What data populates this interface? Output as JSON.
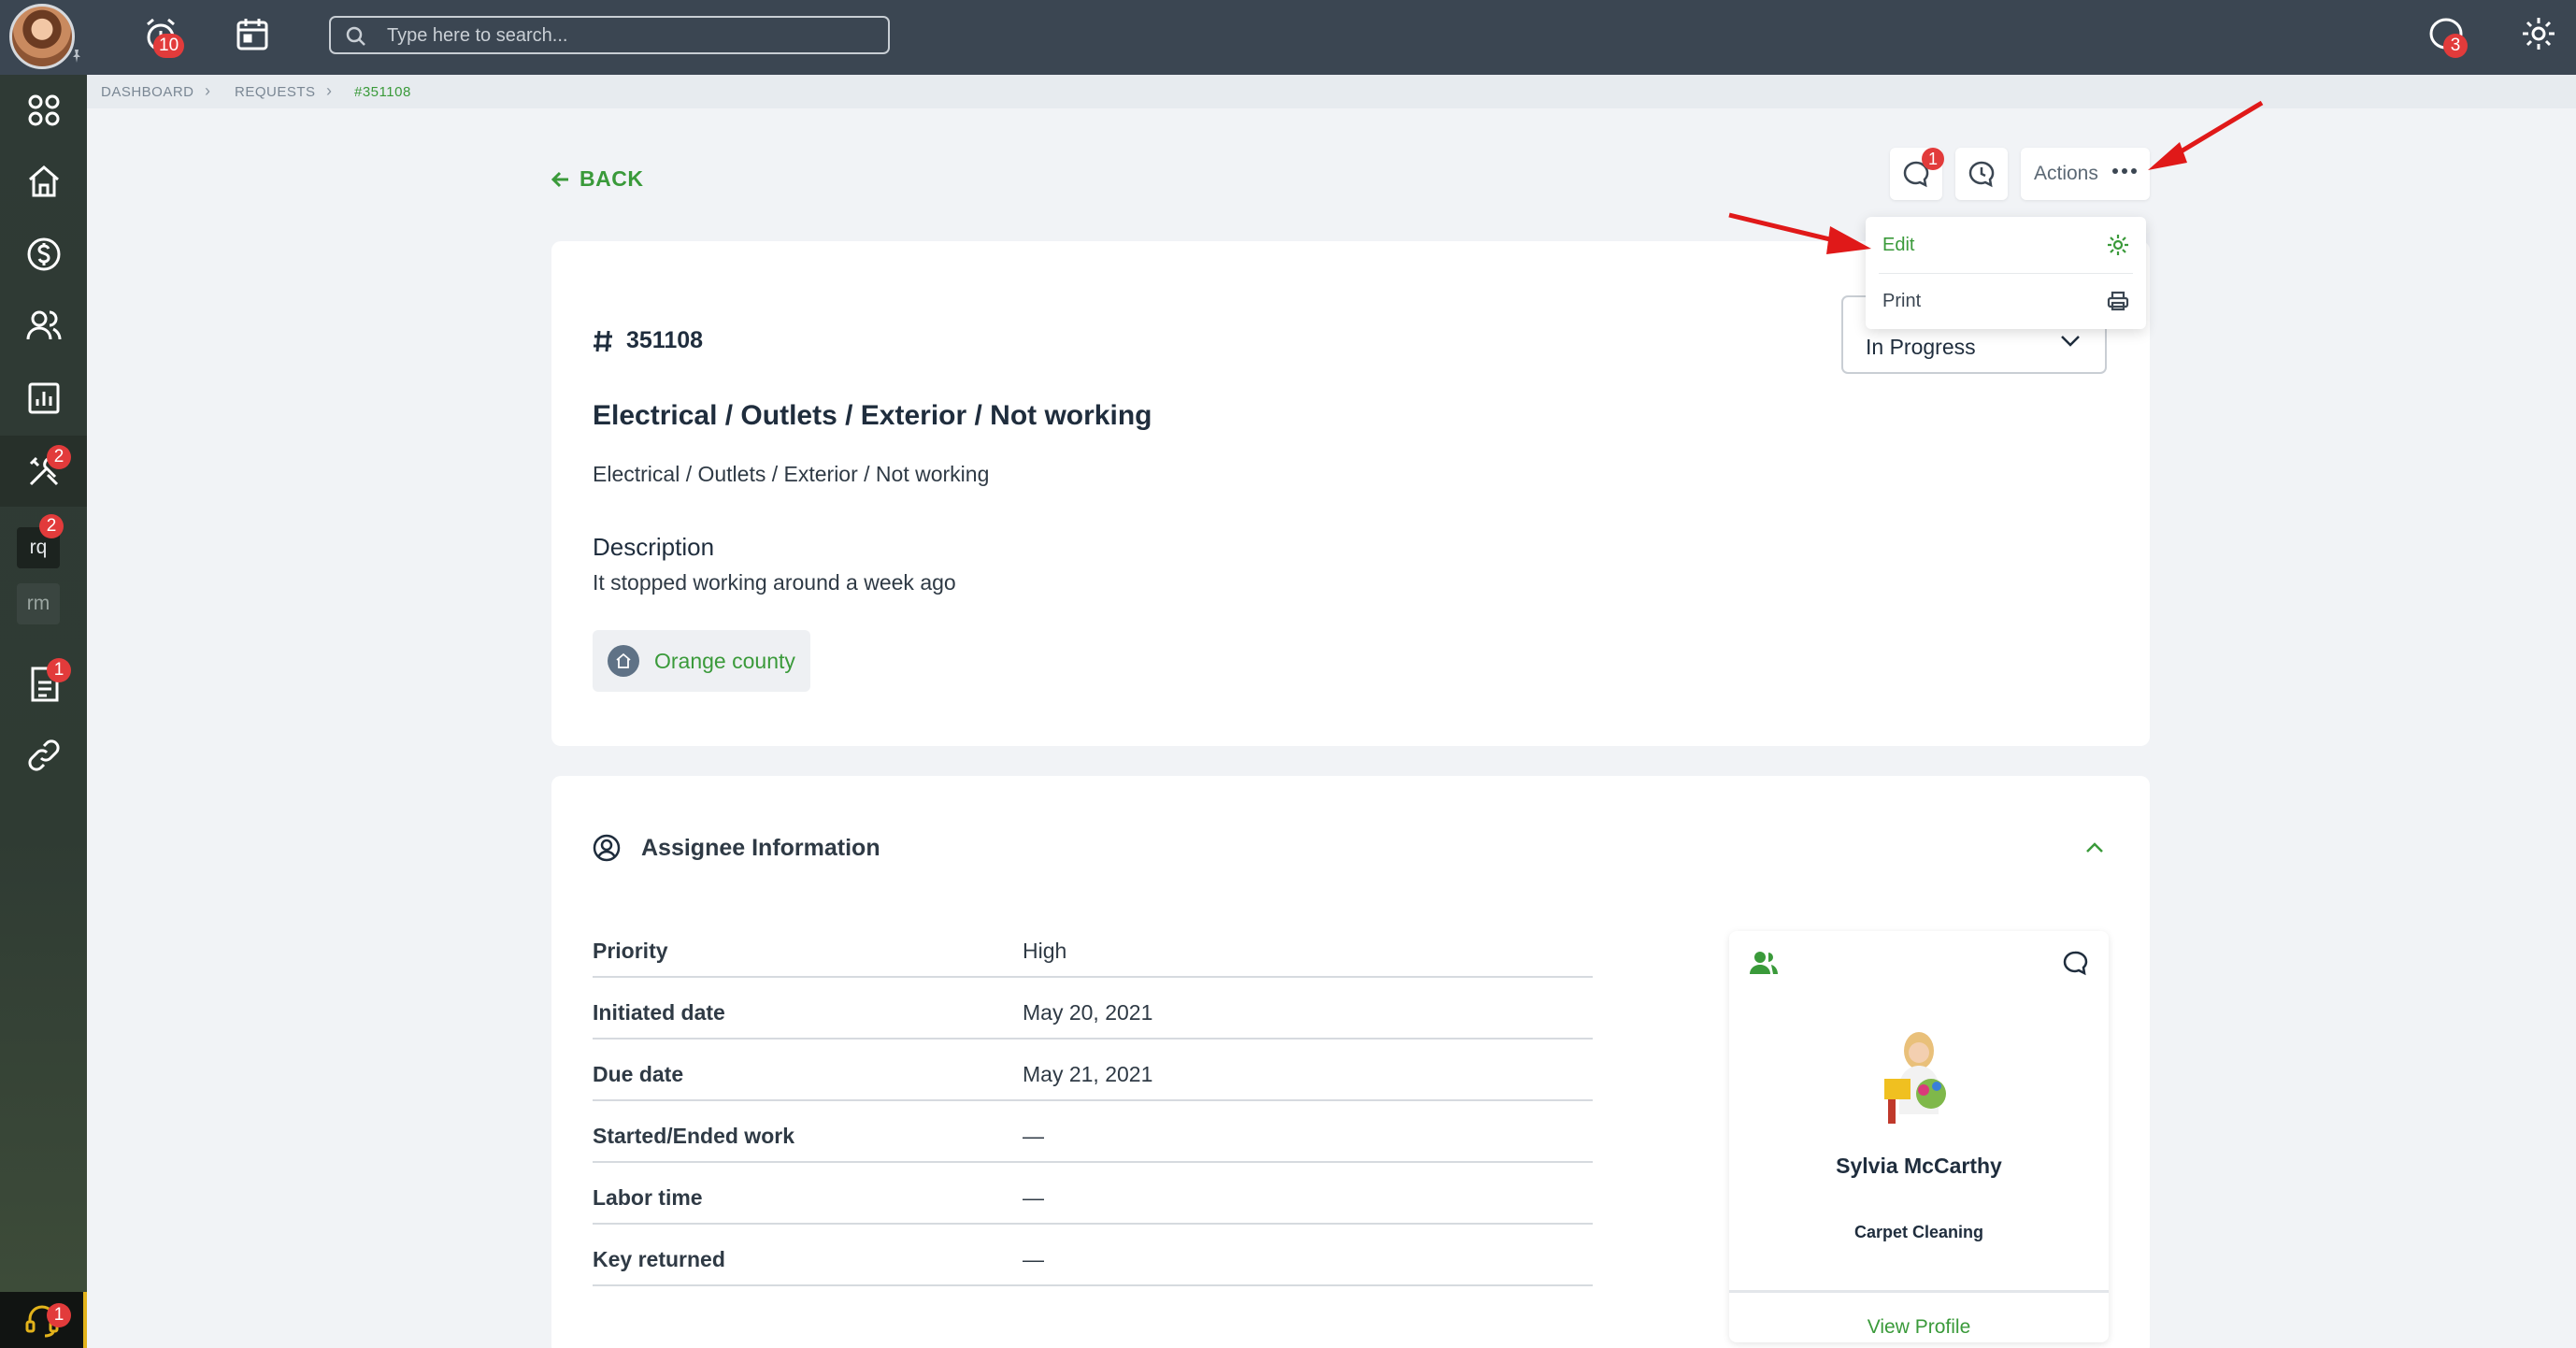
{
  "topbar": {
    "alerts_count": "10",
    "search_placeholder": "Type here to search...",
    "chat_count": "3"
  },
  "sidebar": {
    "maintenance_badge": "2",
    "rq_label": "rq",
    "rq_badge": "2",
    "rm_label": "rm",
    "documents_badge": "1",
    "support_badge": "1"
  },
  "breadcrumb": {
    "items": [
      "DASHBOARD",
      "REQUESTS",
      "#351108"
    ]
  },
  "header": {
    "back_label": "BACK",
    "comments_badge": "1",
    "actions_label": "Actions"
  },
  "actions_menu": {
    "items": [
      "Edit",
      "Print"
    ]
  },
  "request": {
    "id": "351108",
    "title": "Electrical / Outlets / Exterior / Not working",
    "category": "Electrical / Outlets / Exterior / Not working",
    "description_label": "Description",
    "description": "It stopped working around a week ago",
    "location": "Orange county",
    "status": "In Progress"
  },
  "assignee_section": {
    "title": "Assignee Information",
    "rows": [
      {
        "label": "Priority",
        "value": "High"
      },
      {
        "label": "Initiated date",
        "value": "May 20, 2021"
      },
      {
        "label": "Due date",
        "value": "May 21, 2021"
      },
      {
        "label": "Started/Ended work",
        "value": "—"
      },
      {
        "label": "Labor time",
        "value": "—"
      },
      {
        "label": "Key returned",
        "value": "—"
      }
    ],
    "card": {
      "name": "Sylvia McCarthy",
      "role": "Carpet Cleaning",
      "link": "View Profile"
    }
  },
  "colors": {
    "accent_green": "#3a9a3a",
    "topbar": "#3b4652",
    "badge_red": "#e23b3b",
    "annotation_arrow": "#e01919"
  }
}
